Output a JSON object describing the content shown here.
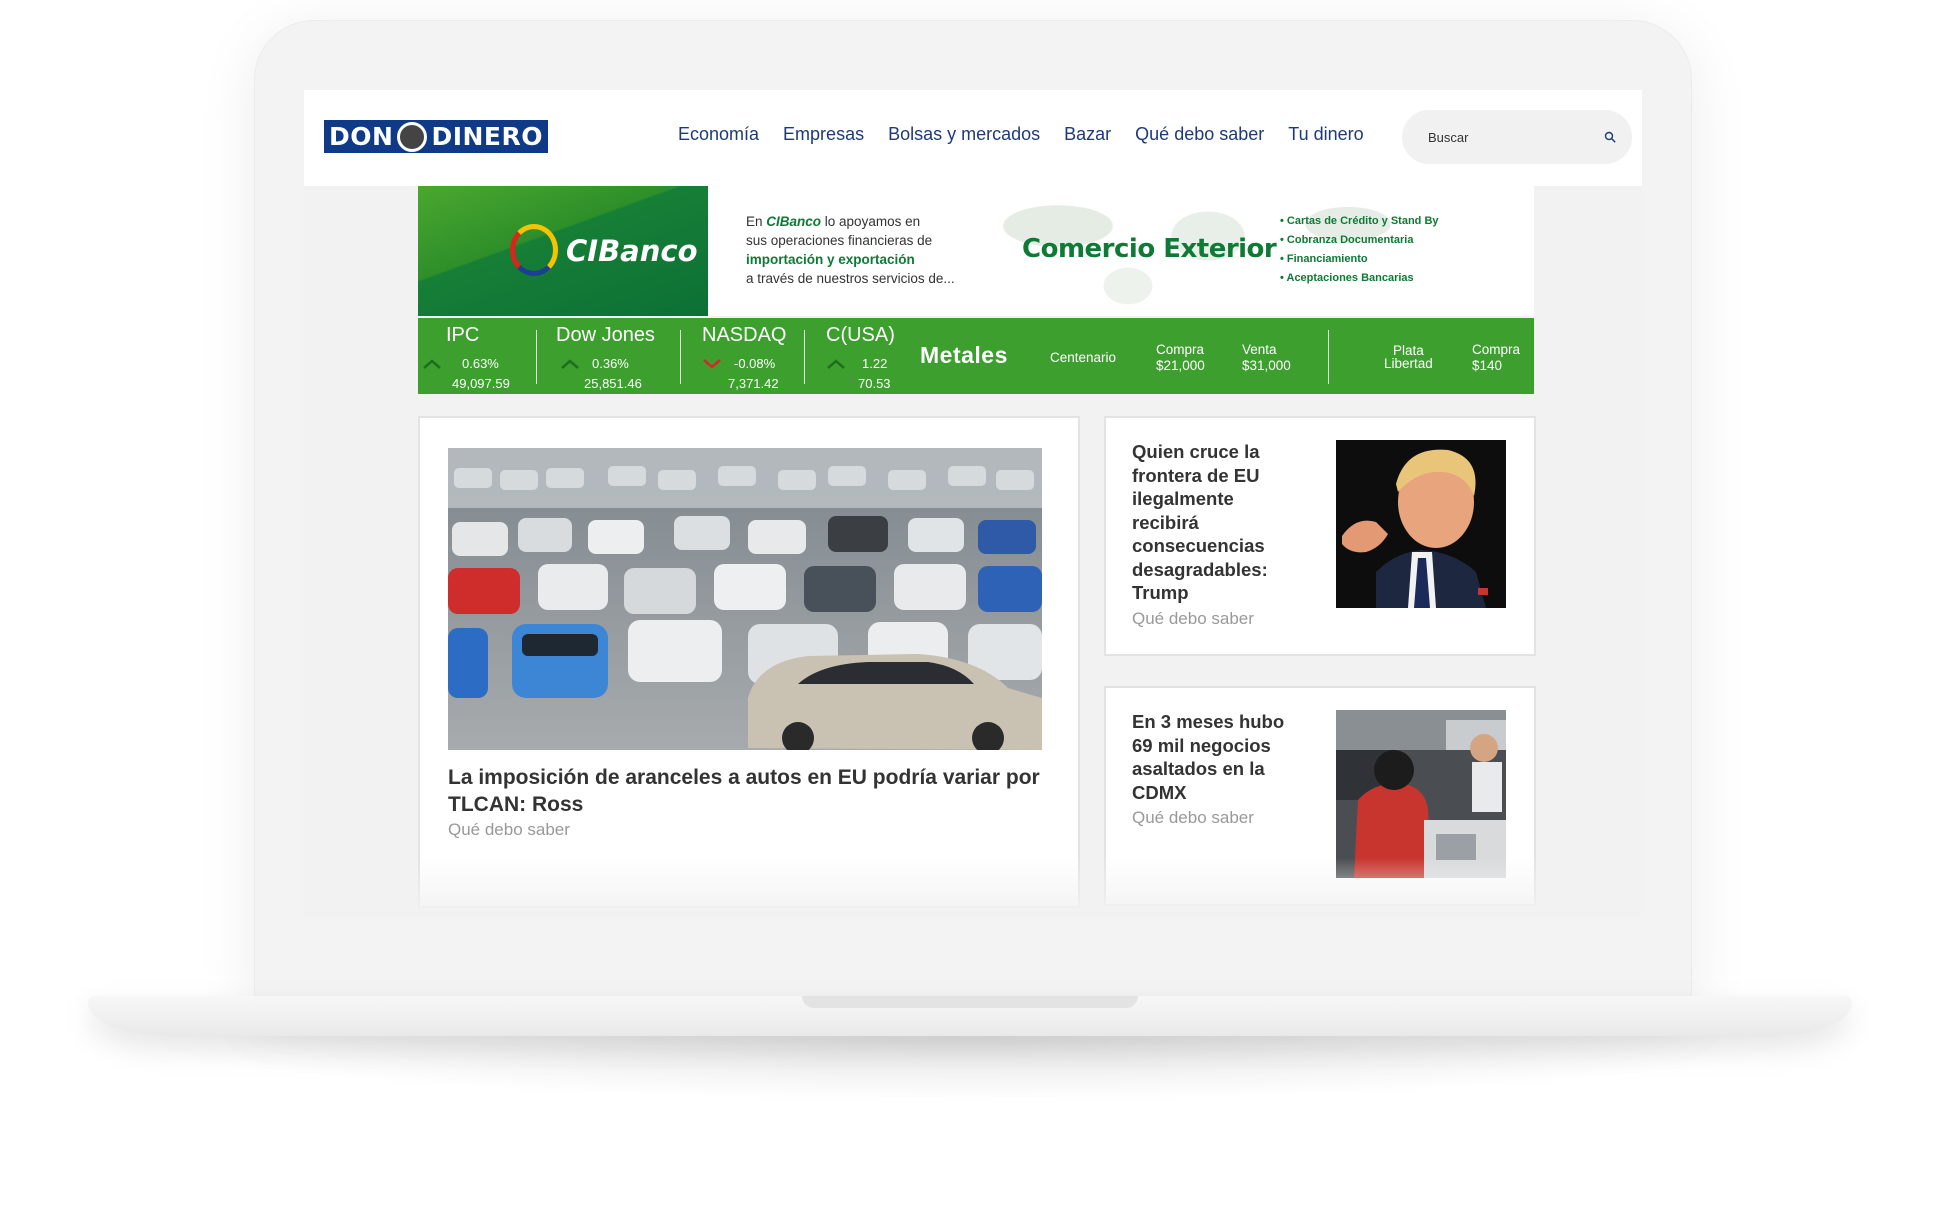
{
  "site": {
    "logo_left": "DON",
    "logo_right": "DINERO"
  },
  "nav": [
    {
      "label": "Economía"
    },
    {
      "label": "Empresas"
    },
    {
      "label": "Bolsas y mercados"
    },
    {
      "label": "Bazar"
    },
    {
      "label": "Qué debo saber"
    },
    {
      "label": "Tu dinero"
    }
  ],
  "search": {
    "placeholder": "Buscar"
  },
  "ad": {
    "brand": "CIBanco",
    "copy_line1_pre": "En ",
    "copy_line1_brand": "CIBanco",
    "copy_line1_post": " lo apoyamos en",
    "copy_line2": "sus operaciones financieras de",
    "copy_line3": "importación y exportación",
    "copy_line4": "a través de nuestros servicios de...",
    "headline": "Comercio Exterior",
    "bullets": [
      "• Cartas de Crédito y Stand By",
      "• Cobranza Documentaria",
      "• Financiamiento",
      "• Aceptaciones Bancarias"
    ]
  },
  "ticker": {
    "indices": [
      {
        "name": "IPC",
        "change": "0.63%",
        "value": "49,097.59",
        "direction": "up"
      },
      {
        "name": "Dow Jones",
        "change": "0.36%",
        "value": "25,851.46",
        "direction": "up"
      },
      {
        "name": "NASDAQ",
        "change": "-0.08%",
        "value": "7,371.42",
        "direction": "down"
      },
      {
        "name": "C(USA)",
        "change": "1.22",
        "value": "70.53",
        "direction": "up"
      }
    ],
    "metales_label": "Metales",
    "metals": [
      {
        "line1": "Centenario",
        "line2": ""
      },
      {
        "line1": "Compra",
        "line2": "$21,000"
      },
      {
        "line1": "Venta",
        "line2": "$31,000"
      },
      {
        "line1": "Plata",
        "line2": "Libertad"
      },
      {
        "line1": "Compra",
        "line2": "$140"
      }
    ],
    "colors": {
      "up": "#1f6e1f",
      "down": "#d8262b"
    }
  },
  "articles": {
    "main": {
      "title": "La imposición de aranceles a autos en EU podría variar por TLCAN: Ross",
      "section": "Qué debo saber",
      "image": "parked-cars-photo"
    },
    "side": [
      {
        "title": "Quien cruce la frontera de EU ilegalmente recibirá consecuencias desagradables: Trump",
        "section": "Qué debo saber",
        "image": "pointing-man-photo"
      },
      {
        "title": "En 3 meses hubo 69 mil negocios asaltados en la CDMX",
        "section": "Qué debo saber",
        "image": "shop-counter-photo"
      }
    ]
  },
  "colors": {
    "nav": "#1d3a7a",
    "logo_bg": "#0f3a88",
    "ad_green": "#0e7a35",
    "ticker_bg": "#3c9f2e"
  }
}
